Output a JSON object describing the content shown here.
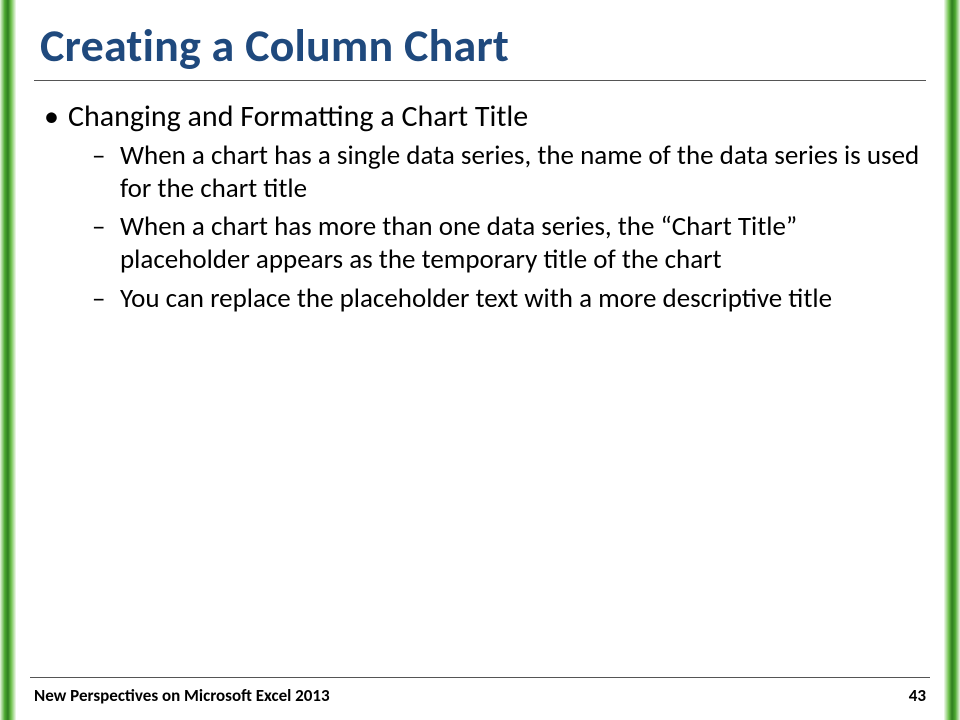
{
  "title": "Creating a Column Chart",
  "bullets": {
    "level1": "Changing and Formatting a Chart Title",
    "level2": [
      "When a chart has a single data series, the name of the data series is used for the chart title",
      "When a chart has more than one data series, the “Chart Title” placeholder appears as the temporary title of the chart",
      "You can replace the placeholder text with a more descriptive title"
    ]
  },
  "footer": {
    "left": "New Perspectives on Microsoft Excel 2013",
    "right": "43"
  }
}
